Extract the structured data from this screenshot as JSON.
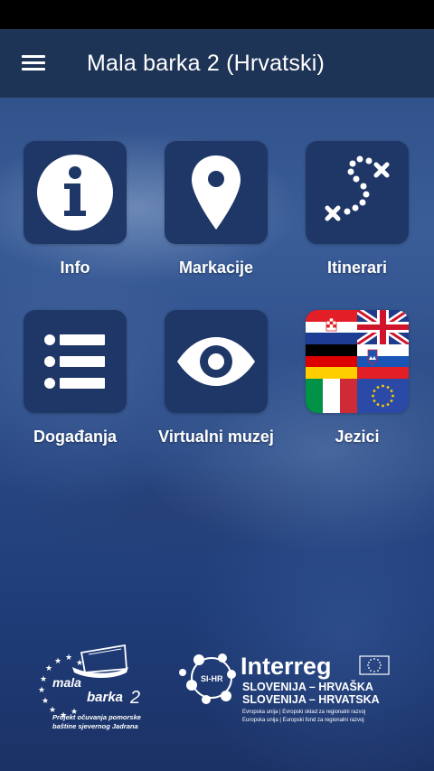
{
  "app": {
    "title": "Mala barka 2 (Hrvatski)"
  },
  "tiles": [
    {
      "label": "Info",
      "icon": "info-icon"
    },
    {
      "label": "Markacije",
      "icon": "map-pin-icon"
    },
    {
      "label": "Itinerari",
      "icon": "route-icon"
    },
    {
      "label": "Događanja",
      "icon": "list-icon"
    },
    {
      "label": "Virtualni muzej",
      "icon": "eye-icon"
    },
    {
      "label": "Jezici",
      "icon": "flags-icon"
    }
  ],
  "footer": {
    "left_logo": {
      "name_line1": "mala",
      "name_line2": "barka",
      "number": "2",
      "tagline_line1": "Projekt očuvanja pomorske",
      "tagline_line2": "baštine sjevernog Jadrana"
    },
    "right_logo": {
      "brand": "Interreg",
      "badge": "SI-HR",
      "line1": "SLOVENIJA – HRVAŠKA",
      "line2": "SLOVENIJA – HRVATSKA",
      "small1": "Evropska unija | Evropski sklad za regionalni razvoj",
      "small2": "Europska unija | Europski fond za regionalni razvoj"
    }
  },
  "colors": {
    "tile_bg": "#1f3766",
    "appbar": "#1e3456",
    "status_bar": "#000000"
  }
}
